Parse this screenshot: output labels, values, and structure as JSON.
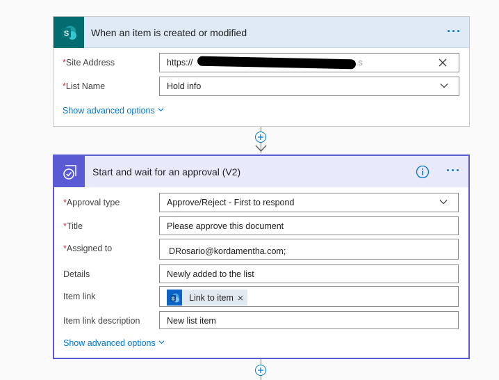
{
  "trigger": {
    "title": "When an item is created or modified",
    "fields": [
      {
        "label": "Site Address",
        "value": "https://",
        "trailing": ".s",
        "required": true
      },
      {
        "label": "List Name",
        "value": "Hold info",
        "required": true
      }
    ],
    "advanced_label": "Show advanced options"
  },
  "approval": {
    "title": "Start and wait for an approval (V2)",
    "fields": [
      {
        "label": "Approval type",
        "value": "Approve/Reject - First to respond",
        "required": true
      },
      {
        "label": "Title",
        "value": "Please approve this document",
        "required": true
      },
      {
        "label": "Assigned to",
        "value": "DRosario@kordamentha.com;",
        "required": true
      },
      {
        "label": "Details",
        "value": "Newly added to the list",
        "required": false
      },
      {
        "label": "Item link",
        "token": "Link to item",
        "required": false
      },
      {
        "label": "Item link description",
        "value": "New list item",
        "required": false
      }
    ],
    "advanced_label": "Show advanced options"
  },
  "colors": {
    "accent": "#0078d4",
    "approval_purple": "#5a5bd4",
    "approval_header": "#e9e9fc",
    "trigger_header": "#dfeaf6",
    "sharepoint_teal": "#036c70",
    "required": "#d13438"
  },
  "icons": {
    "sharepoint": "sharepoint-logo-icon",
    "approval": "approval-check-icon",
    "more": "more-dots-icon",
    "info": "info-icon",
    "clear": "close-icon",
    "dropdown": "chevron-down-icon",
    "add": "plus-icon"
  }
}
